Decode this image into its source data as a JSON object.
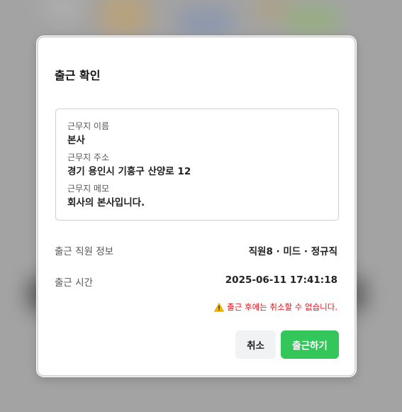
{
  "modal": {
    "title": "출근 확인"
  },
  "workplace": {
    "name_label": "근무지 이름",
    "name_value": "본사",
    "address_label": "근무지 주소",
    "address_value": "경기 용인시 기흥구 산양로 12",
    "memo_label": "근무지 메모",
    "memo_value": "회사의 본사입니다."
  },
  "employee": {
    "label": "출근 직원 정보",
    "value": "직원8 · 미드 · 정규직"
  },
  "time": {
    "label": "출근 시간",
    "value": "2025-06-11 17:41:18"
  },
  "warning": {
    "icon": "warning-icon",
    "text": "출근 후에는 취소할 수 없습니다."
  },
  "buttons": {
    "cancel_label": "취소",
    "confirm_label": "출근하기"
  },
  "colors": {
    "confirm": "#33c65a",
    "warning": "#e0141a",
    "warning_icon": "#f5b400"
  }
}
